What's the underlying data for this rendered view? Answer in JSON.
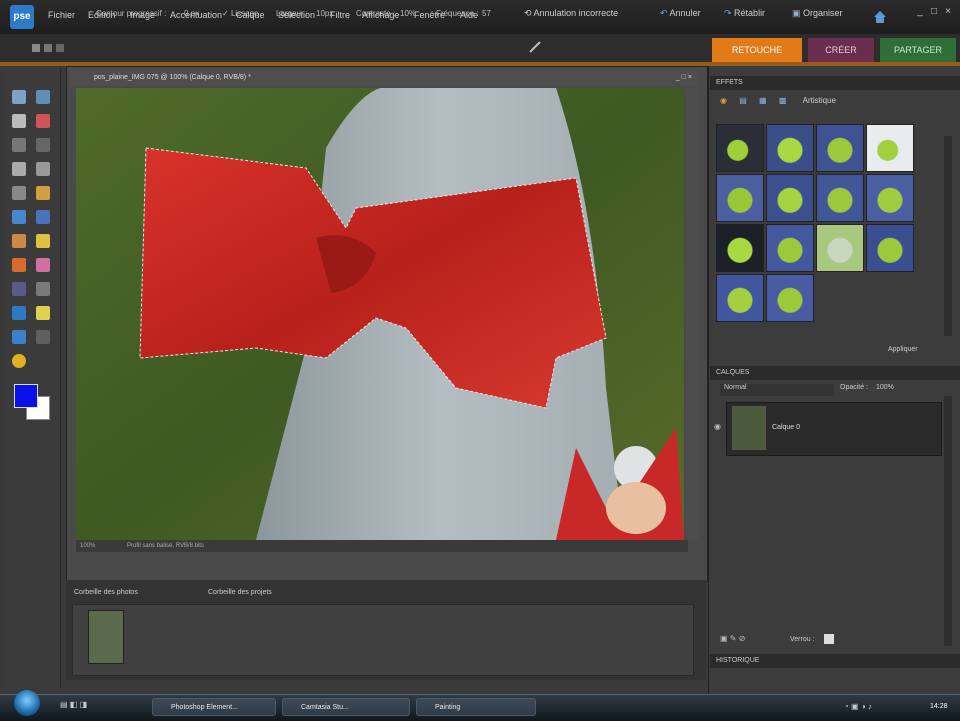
{
  "app": {
    "logo_text": "pse",
    "menu": [
      "Fichier",
      "Edition",
      "Image",
      "Accentuation",
      "Calque",
      "Sélection",
      "Filtre",
      "Affichage",
      "Fenêtre",
      "Aide"
    ],
    "undo_label": "Annulation incorrecte",
    "btn_creer": "Annuler",
    "btn_retablir": "Rétablir",
    "btn_organiser": "Organiser",
    "win_min": "_",
    "win_max": "□",
    "win_close": "×"
  },
  "options": {
    "contour_label": "Contour progressif :",
    "contour_value": "0 px",
    "lissage": "Lissage",
    "largeur_label": "Largeur :",
    "largeur_value": "10px",
    "contraste_label": "Contraste :",
    "contraste_value": "10%",
    "frequence_label": "Fréquence :",
    "frequence_value": "57"
  },
  "tabs": {
    "edit": "RETOUCHE",
    "creer": "CRÉER",
    "partager": "PARTAGER"
  },
  "document": {
    "title": "pos_plaine_IMG 075 @ 100% (Calque 0, RVB/8) *",
    "zoom": "100%",
    "status": "Profil sans balise, RVB/8 bits"
  },
  "bin": {
    "tab1": "Corbeille des photos",
    "tab2": "Corbeille des projets"
  },
  "panels": {
    "effets_header": "EFFETS",
    "effets_filter": "Artistique",
    "effets_apply": "Appliquer",
    "calques_header": "CALQUES",
    "calques_mode": "Normal",
    "calques_opacity_label": "Opacité :",
    "calques_opacity": "100%",
    "layer_name": "Calque 0",
    "lock_label": "Verrou :",
    "historique_header": "HISTORIQUE"
  },
  "taskbar": {
    "btn1": "Photoshop Element...",
    "btn2": "Camtasia Stu...",
    "btn3": "Painting",
    "time": "14:28"
  },
  "colors": {
    "foreground": "#0a10e8",
    "background": "#ffffff",
    "edit_tab": "#e07b17",
    "creer_tab": "#6b2d4d",
    "partager_tab": "#2f6e36"
  }
}
